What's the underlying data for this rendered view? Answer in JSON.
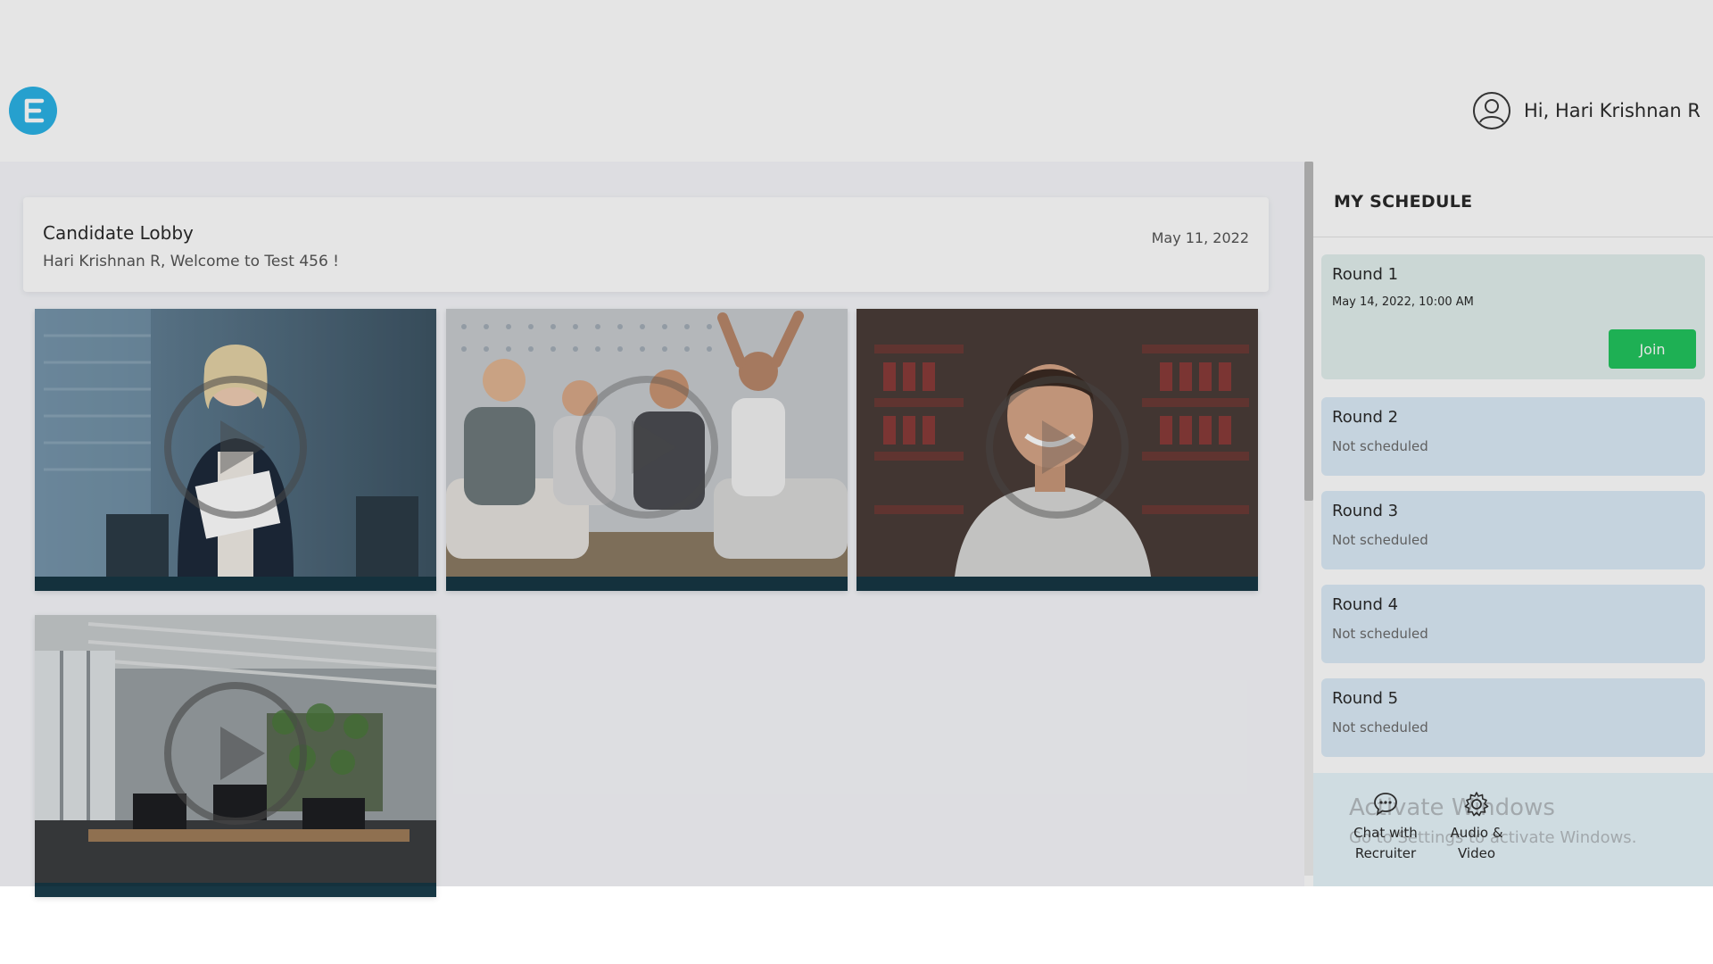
{
  "header": {
    "logo_letter": "E",
    "user_greeting": "Hi, Hari Krishnan R"
  },
  "lobby": {
    "title": "Candidate Lobby",
    "subtitle": "Hari Krishnan R, Welcome to Test 456 !",
    "date": "May 11, 2022"
  },
  "videos": [
    {
      "name": "video-tile-1"
    },
    {
      "name": "video-tile-2"
    },
    {
      "name": "video-tile-3"
    },
    {
      "name": "video-tile-4"
    }
  ],
  "schedule": {
    "title": "MY SCHEDULE",
    "rounds": [
      {
        "title": "Round 1",
        "time": "May 14, 2022, 10:00 AM",
        "action_label": "Join"
      },
      {
        "title": "Round 2",
        "status": "Not scheduled"
      },
      {
        "title": "Round 3",
        "status": "Not scheduled"
      },
      {
        "title": "Round 4",
        "status": "Not scheduled"
      },
      {
        "title": "Round 5",
        "status": "Not scheduled"
      }
    ]
  },
  "actions": {
    "chat_line1": "Chat with",
    "chat_line2": "Recruiter",
    "av_line1": "Audio &",
    "av_line2": "Video"
  },
  "watermark": {
    "title": "Activate Windows",
    "subtitle": "Go to Settings to activate Windows."
  },
  "colors": {
    "logo": "#2bb3e6",
    "join_button": "#22c55e",
    "round_active_bg": "#e2f0ee",
    "round_bg": "#dcebf8"
  }
}
